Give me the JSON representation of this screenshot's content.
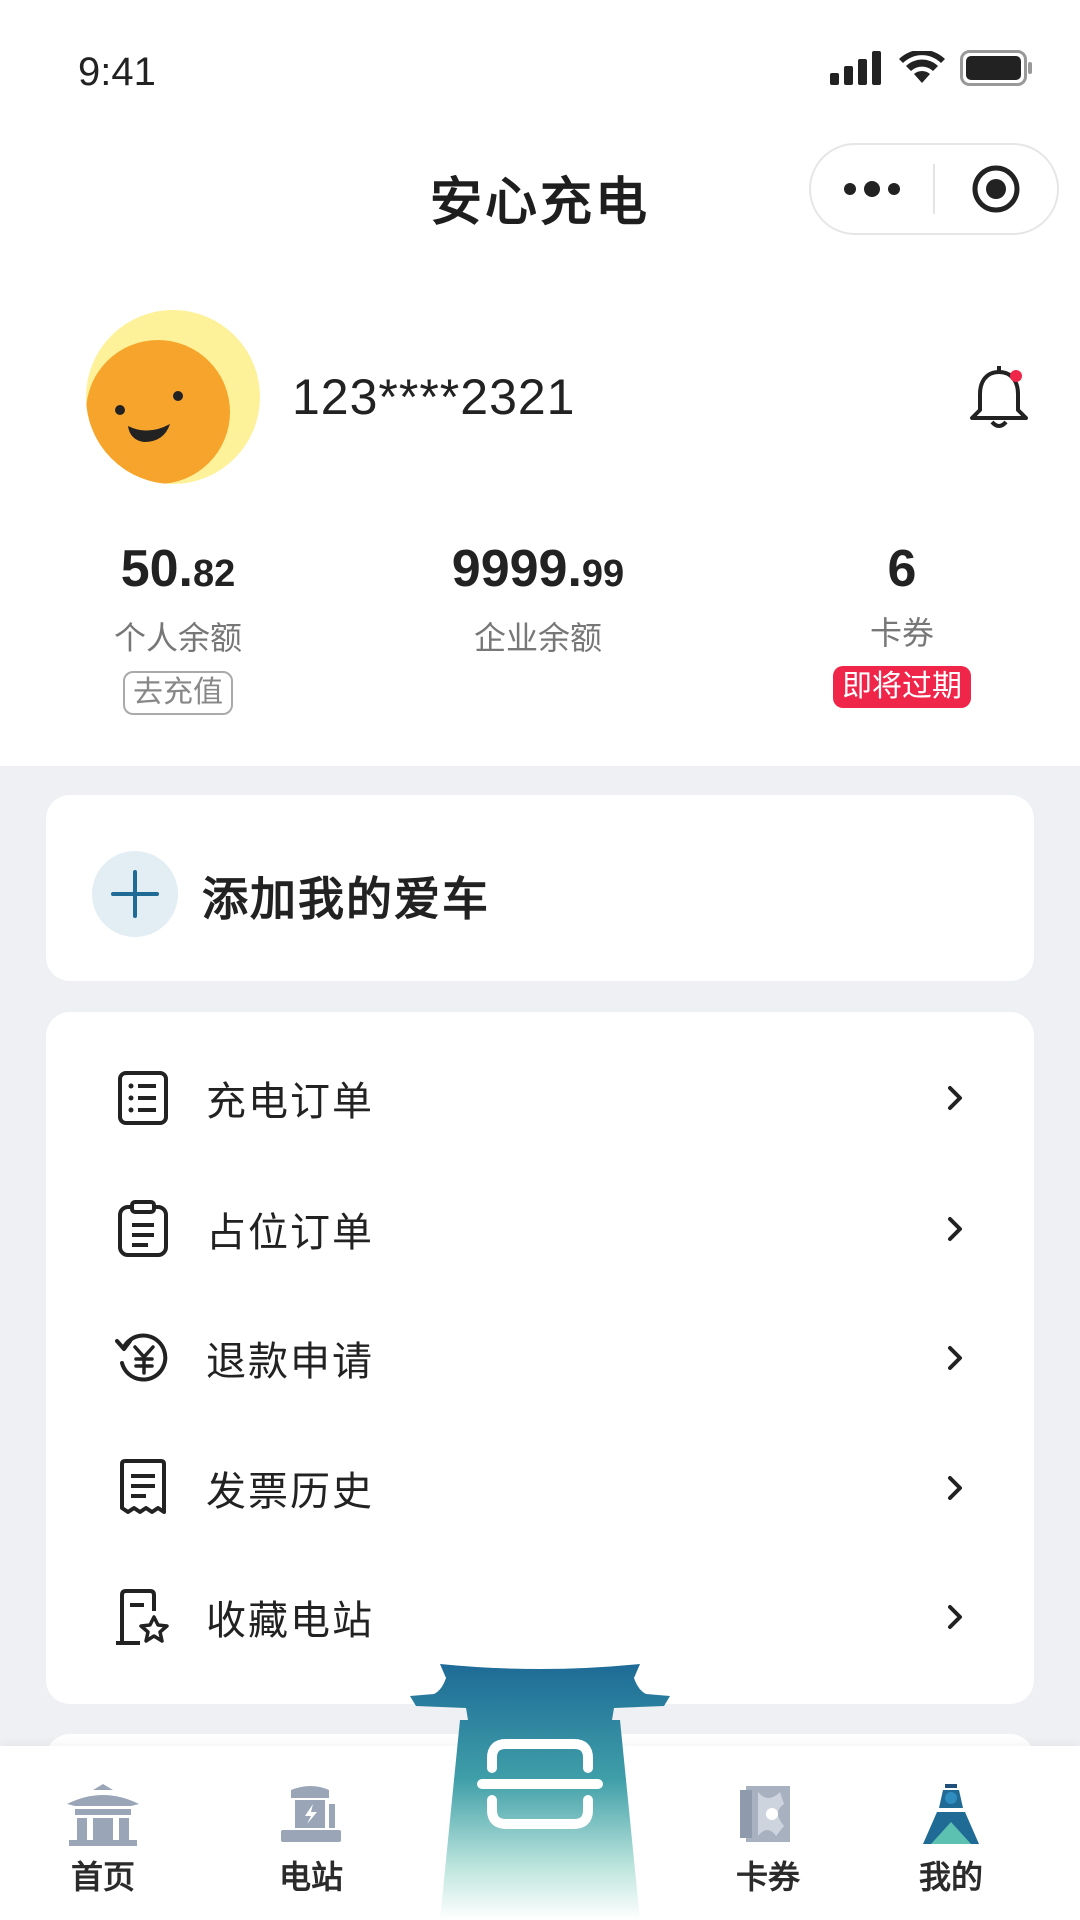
{
  "status_bar": {
    "time": "9:41"
  },
  "nav": {
    "title": "安心充电"
  },
  "profile": {
    "username": "123****2321"
  },
  "stats": {
    "personal": {
      "value_main": "50.",
      "value_small": "82",
      "label": "个人余额",
      "action": "去充值"
    },
    "enterprise": {
      "value_main": "9999.",
      "value_small": "99",
      "label": "企业余额"
    },
    "coupons": {
      "value": "6",
      "label": "卡券",
      "badge": "即将过期"
    }
  },
  "add_car": {
    "label": "添加我的爱车"
  },
  "menu": {
    "items": [
      {
        "label": "充电订单",
        "icon": "order-list-icon"
      },
      {
        "label": "占位订单",
        "icon": "clipboard-icon"
      },
      {
        "label": "退款申请",
        "icon": "refund-icon"
      },
      {
        "label": "发票历史",
        "icon": "invoice-icon"
      },
      {
        "label": "收藏电站",
        "icon": "favorite-station-icon"
      }
    ]
  },
  "tabs": [
    {
      "label": "首页",
      "icon": "home-pavilion-icon"
    },
    {
      "label": "电站",
      "icon": "station-icon"
    },
    {
      "label": "",
      "icon": "scan-icon"
    },
    {
      "label": "卡券",
      "icon": "coupon-icon"
    },
    {
      "label": "我的",
      "icon": "profile-icon"
    }
  ],
  "colors": {
    "accent": "#1f6b96",
    "badge_red": "#f0254a",
    "background_grey": "#eef0f3",
    "avatar_orange": "#f7a42c",
    "avatar_yellow": "#fdf29a"
  }
}
